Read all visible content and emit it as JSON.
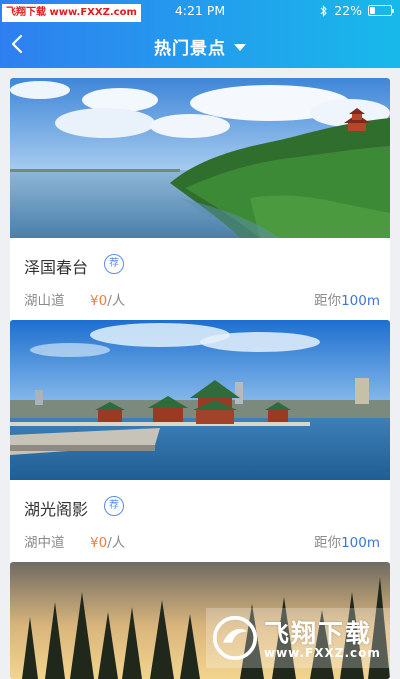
{
  "status_bar": {
    "watermark": "飞翔下载 www.FXXZ.com",
    "time": "4:21 PM",
    "battery_text": "22%",
    "battery_level": 0.22,
    "bluetooth_icon": "bluetooth-icon"
  },
  "nav": {
    "title": "热门景点",
    "back_icon": "back-arrow-icon",
    "dropdown_icon": "caret-down-icon"
  },
  "spots": [
    {
      "name": "泽国春台",
      "badge": "荐",
      "road": "湖山道",
      "price_symbol": "¥0",
      "price_unit": "/人",
      "distance_prefix": "距你",
      "distance": "100m"
    },
    {
      "name": "湖光阁影",
      "badge": "荐",
      "road": "湖中道",
      "price_symbol": "¥0",
      "price_unit": "/人",
      "distance_prefix": "距你",
      "distance": "100m"
    }
  ],
  "watermark_logo": {
    "text": "飞翔下载",
    "url": "www.FXXZ.com"
  },
  "colors": {
    "header_start": "#2f7ff0",
    "header_end": "#18b9ea",
    "price": "#f47c3c",
    "distance": "#3b76d8",
    "badge": "#5b8ee6"
  }
}
